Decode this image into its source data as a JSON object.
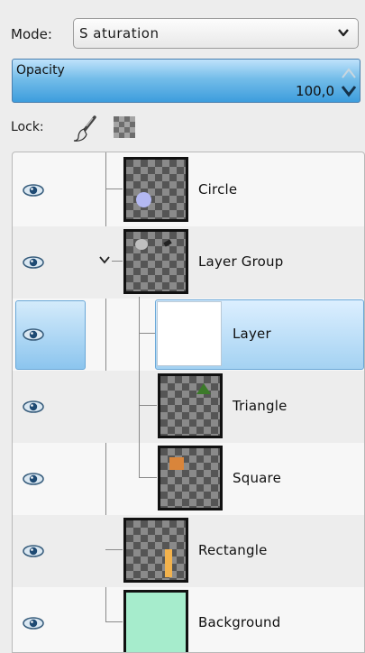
{
  "mode": {
    "label": "Mode:",
    "value": "S aturation"
  },
  "opacity": {
    "label": "Opacity",
    "value": "100,0"
  },
  "lock": {
    "label": "Lock:"
  },
  "layers": [
    {
      "name": "Circle",
      "visible": true,
      "selected": false,
      "level": 1
    },
    {
      "name": "Layer Group",
      "visible": true,
      "selected": false,
      "level": 1,
      "group": true,
      "expanded": true
    },
    {
      "name": "Layer",
      "visible": true,
      "selected": true,
      "level": 2
    },
    {
      "name": "Triangle",
      "visible": true,
      "selected": false,
      "level": 2
    },
    {
      "name": "Square",
      "visible": true,
      "selected": false,
      "level": 2
    },
    {
      "name": "Rectangle",
      "visible": true,
      "selected": false,
      "level": 1
    },
    {
      "name": "Background",
      "visible": true,
      "selected": false,
      "level": 1
    }
  ],
  "icons": {
    "mode_dropdown": "chevron-down-icon",
    "opacity_spin": "spin-arrows-icon",
    "lock_pixels": "paintbrush-icon",
    "lock_alpha": "checkerboard-icon",
    "visibility": "eye-icon",
    "group_expander": "chevron-down-icon"
  },
  "colors": {
    "selection": "#8cc5ee",
    "opacity_bar": "#3d9ddd",
    "background_layer": "#a6eccc",
    "rectangle_fill": "#f2b24c",
    "circle_fill": "#b3b8f2",
    "triangle_fill": "#3c7a2a",
    "square_fill": "#d9853b"
  }
}
